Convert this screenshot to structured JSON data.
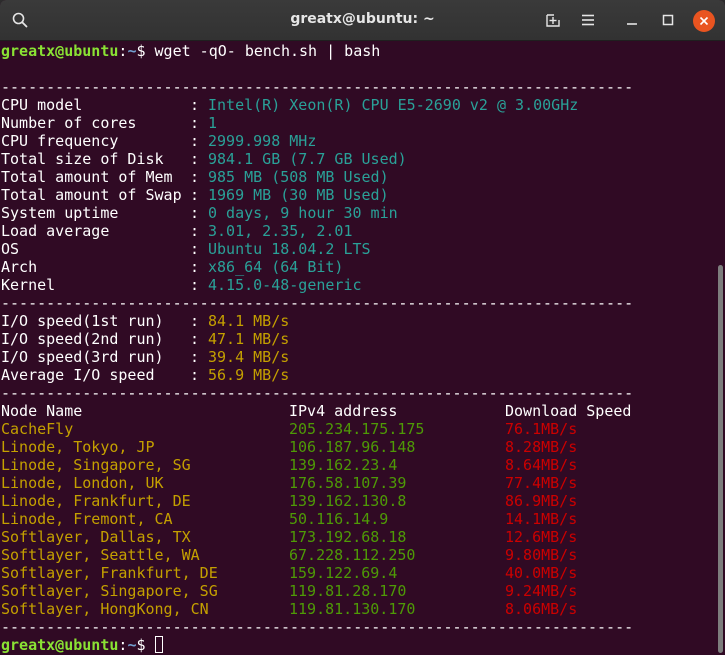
{
  "window": {
    "title": "greatx@ubuntu: ~",
    "buttons": [
      "search-icon",
      "new-tab-icon",
      "menu-icon",
      "minimize-icon",
      "maximize-icon",
      "close-icon"
    ]
  },
  "prompt": {
    "user_host": "greatx@ubuntu",
    "colon": ":",
    "path": "~",
    "dollar": "$ ",
    "command": "wget -qO- bench.sh | bash"
  },
  "separator": "----------------------------------------------------------------------",
  "system_info": [
    {
      "label": "CPU model",
      "value": "Intel(R) Xeon(R) CPU E5-2690 v2 @ 3.00GHz"
    },
    {
      "label": "Number of cores",
      "value": "1"
    },
    {
      "label": "CPU frequency",
      "value": "2999.998 MHz"
    },
    {
      "label": "Total size of Disk",
      "value": "984.1 GB (7.7 GB Used)"
    },
    {
      "label": "Total amount of Mem",
      "value": "985 MB (508 MB Used)"
    },
    {
      "label": "Total amount of Swap",
      "value": "1969 MB (30 MB Used)"
    },
    {
      "label": "System uptime",
      "value": "0 days, 9 hour 30 min"
    },
    {
      "label": "Load average",
      "value": "3.01, 2.35, 2.01"
    },
    {
      "label": "OS",
      "value": "Ubuntu 18.04.2 LTS"
    },
    {
      "label": "Arch",
      "value": "x86_64 (64 Bit)"
    },
    {
      "label": "Kernel",
      "value": "4.15.0-48-generic"
    }
  ],
  "io_speed": [
    {
      "label": "I/O speed(1st run)",
      "value": "84.1 MB/s"
    },
    {
      "label": "I/O speed(2nd run)",
      "value": "47.1 MB/s"
    },
    {
      "label": "I/O speed(3rd run)",
      "value": "39.4 MB/s"
    },
    {
      "label": "Average I/O speed",
      "value": "56.9 MB/s"
    }
  ],
  "speed_table": {
    "headers": [
      "Node Name",
      "IPv4 address",
      "Download Speed"
    ],
    "rows": [
      {
        "node": "CacheFly",
        "ip": "205.234.175.175",
        "speed": "76.1MB/s"
      },
      {
        "node": "Linode, Tokyo, JP",
        "ip": "106.187.96.148",
        "speed": "8.28MB/s"
      },
      {
        "node": "Linode, Singapore, SG",
        "ip": "139.162.23.4",
        "speed": "8.64MB/s"
      },
      {
        "node": "Linode, London, UK",
        "ip": "176.58.107.39",
        "speed": "77.4MB/s"
      },
      {
        "node": "Linode, Frankfurt, DE",
        "ip": "139.162.130.8",
        "speed": "86.9MB/s"
      },
      {
        "node": "Linode, Fremont, CA",
        "ip": "50.116.14.9",
        "speed": "14.1MB/s"
      },
      {
        "node": "Softlayer, Dallas, TX",
        "ip": "173.192.68.18",
        "speed": "12.6MB/s"
      },
      {
        "node": "Softlayer, Seattle, WA",
        "ip": "67.228.112.250",
        "speed": "9.80MB/s"
      },
      {
        "node": "Softlayer, Frankfurt, DE",
        "ip": "159.122.69.4",
        "speed": "40.0MB/s"
      },
      {
        "node": "Softlayer, Singapore, SG",
        "ip": "119.81.28.170",
        "speed": "9.24MB/s"
      },
      {
        "node": "Softlayer, HongKong, CN",
        "ip": "119.81.130.170",
        "speed": "8.06MB/s"
      }
    ]
  },
  "colors": {
    "background": "#300a24",
    "label": "#ffffff",
    "sysinfo_value": "#2aa198",
    "io_value": "#c4a000",
    "node_name": "#c4a000",
    "ip": "#4e9a06",
    "speed": "#cc0000",
    "close_button": "#e95420"
  }
}
